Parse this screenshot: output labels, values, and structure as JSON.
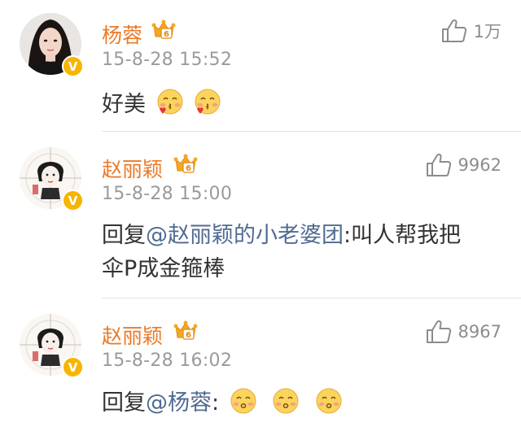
{
  "comments": [
    {
      "author": "杨蓉",
      "time": "15-8-28 15:52",
      "likes": "1万",
      "text": "好美",
      "emojis": [
        "kiss-heart-emoji",
        "kiss-heart-emoji"
      ]
    },
    {
      "author": "赵丽颖",
      "time": "15-8-28 15:00",
      "likes": "9962",
      "reply_prefix": "回复",
      "mention": "@赵丽颖的小老婆团",
      "text_line1": ":叫人帮我把",
      "text_line2": "伞P成金箍棒"
    },
    {
      "author": "赵丽颖",
      "time": "15-8-28 16:02",
      "likes": "8967",
      "reply_prefix": "回复",
      "mention": "@杨蓉",
      "suffix": ":",
      "emojis": [
        "kiss-emoji",
        "kiss-emoji",
        "kiss-emoji"
      ]
    }
  ],
  "colors": {
    "name": "#eb7a28",
    "mention": "#506b92",
    "time": "#9a9a9a",
    "verify_badge": "#f7b500"
  }
}
